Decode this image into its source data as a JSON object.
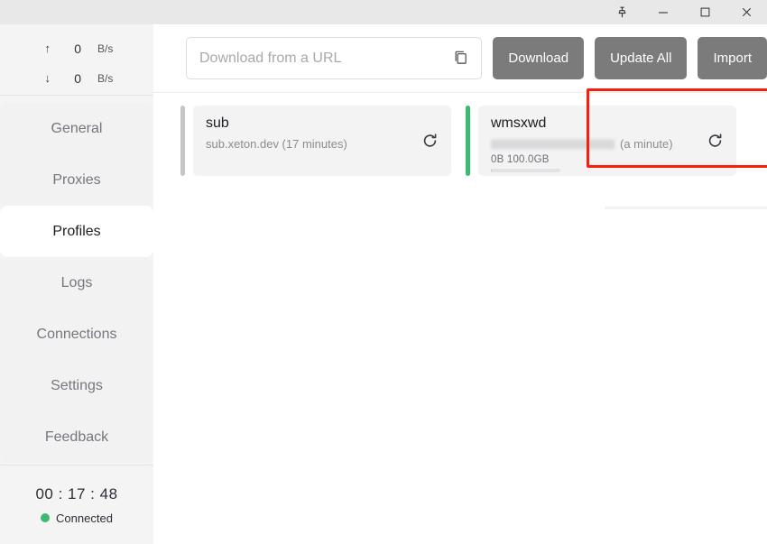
{
  "window": {
    "controls": [
      {
        "name": "pin-icon",
        "label": "Pin"
      },
      {
        "name": "minimize-icon",
        "label": "Minimize"
      },
      {
        "name": "maximize-icon",
        "label": "Maximize"
      },
      {
        "name": "close-icon",
        "label": "Close"
      }
    ]
  },
  "sidebar": {
    "speed": {
      "upload": {
        "arrow": "↑",
        "value": "0",
        "unit": "B/s"
      },
      "download": {
        "arrow": "↓",
        "value": "0",
        "unit": "B/s"
      }
    },
    "items": [
      {
        "label": "General",
        "active": false
      },
      {
        "label": "Proxies",
        "active": false
      },
      {
        "label": "Profiles",
        "active": true
      },
      {
        "label": "Logs",
        "active": false
      },
      {
        "label": "Connections",
        "active": false
      },
      {
        "label": "Settings",
        "active": false
      },
      {
        "label": "Feedback",
        "active": false
      }
    ],
    "status": {
      "timer": "00 : 17 : 48",
      "connection_label": "Connected",
      "connection_color": "#3dba72"
    }
  },
  "toolbar": {
    "url_value": "",
    "url_placeholder": "Download from a URL",
    "copy_icon": "copy-icon",
    "buttons": [
      {
        "label": "Download",
        "name": "download-button"
      },
      {
        "label": "Update All",
        "name": "update-all-button"
      },
      {
        "label": "Import",
        "name": "import-button"
      }
    ],
    "button_color": "#7b7b7b"
  },
  "profiles": [
    {
      "title": "sub",
      "subtitle": "sub.xeton.dev (17 minutes)",
      "redacted": false,
      "accent_color": "#c6c6c8",
      "active": false,
      "usage": null,
      "meter_percent": null,
      "refresh_icon": "refresh-icon"
    },
    {
      "title": "wmsxwd",
      "subtitle": "(a minute)",
      "redacted": true,
      "accent_color": "#3dba72",
      "active": true,
      "usage": "0B   100.0GB",
      "meter_percent": 1,
      "refresh_icon": "refresh-icon"
    }
  ],
  "annotation": {
    "highlight_color": "#f81e09",
    "target": "wmsxwd"
  }
}
